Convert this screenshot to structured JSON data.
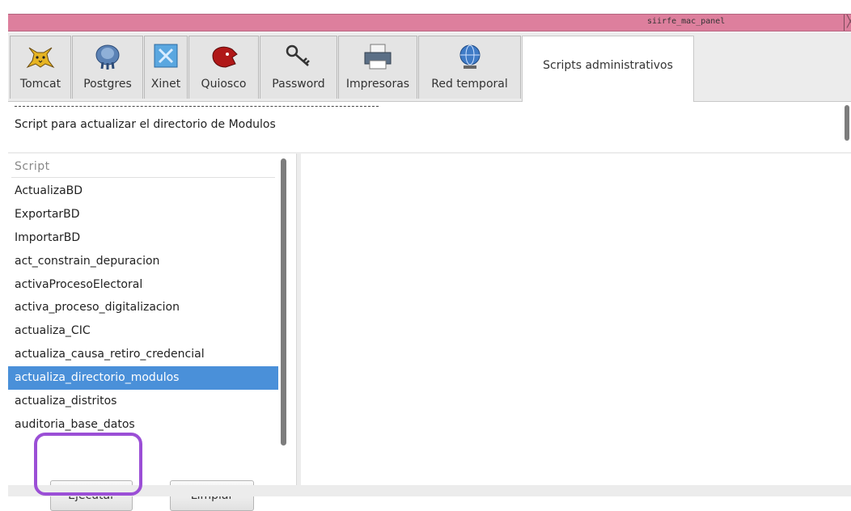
{
  "window": {
    "title": "siirfe_mac_panel",
    "close_glyph": "╳"
  },
  "tabs": [
    {
      "label": "Tomcat",
      "icon": "tomcat-icon"
    },
    {
      "label": "Postgres",
      "icon": "postgres-elephant-icon"
    },
    {
      "label": "Xinet",
      "icon": "xinet-icon"
    },
    {
      "label": "Quiosco",
      "icon": "quiosco-red-head-icon"
    },
    {
      "label": "Password",
      "icon": "keys-icon"
    },
    {
      "label": "Impresoras",
      "icon": "printer-icon"
    },
    {
      "label": "Red temporal",
      "icon": "network-globe-icon"
    },
    {
      "label": "Scripts administrativos",
      "active": true
    }
  ],
  "description": {
    "separator": "----------------------------------------------------------------------",
    "text": "Script para actualizar el directorio de Modulos"
  },
  "script_list": {
    "header": "Script",
    "items": [
      "ActualizaBD",
      "ExportarBD",
      "ImportarBD",
      "act_constrain_depuracion",
      "activaProcesoElectoral",
      "activa_proceso_digitalizacion",
      "actualiza_CIC",
      "actualiza_causa_retiro_credencial",
      "actualiza_directorio_modulos",
      "actualiza_distritos",
      "auditoria_base_datos"
    ],
    "selected_index": 8
  },
  "buttons": {
    "execute": "Ejecutar",
    "clear": "Limpiar"
  },
  "colors": {
    "titlebar": "#dd7f9d",
    "selection": "#4a90d9",
    "highlight_outline": "#9b4fd6"
  }
}
